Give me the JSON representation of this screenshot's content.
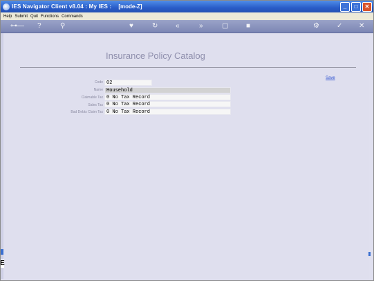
{
  "window": {
    "title": "IES Navigator Client v8.04 : My IES :",
    "mode": "[mode-Z]"
  },
  "menubar": {
    "items": [
      "Help",
      "Submit",
      "Quit",
      "Functions",
      "Commands"
    ]
  },
  "toolbar": {
    "icons": [
      "key-icon",
      "help-icon",
      "search-icon",
      "heart-icon",
      "refresh-icon",
      "rewind-icon",
      "fast-forward-icon",
      "page-icon",
      "stop-icon",
      "settings-icon",
      "check-icon",
      "close-icon"
    ]
  },
  "page": {
    "title": "Insurance Policy Catalog",
    "save_label": "Save"
  },
  "form": {
    "code": {
      "label": "Code",
      "value": "02"
    },
    "name": {
      "label": "Name",
      "value": "Household"
    },
    "claimable_tax": {
      "label": "Claimable Tax",
      "value": "0 No Tax Record"
    },
    "sales_tax": {
      "label": "Sales Tax",
      "value": "0 No Tax Record"
    },
    "bad_debt_claim_tax": {
      "label": "Bad Debts Claim Tax",
      "value": "0 No Tax Record"
    }
  },
  "colors": {
    "titlebar": "#2a5dc8",
    "content_bg": "#dfdfee",
    "link": "#2a4fd0"
  }
}
